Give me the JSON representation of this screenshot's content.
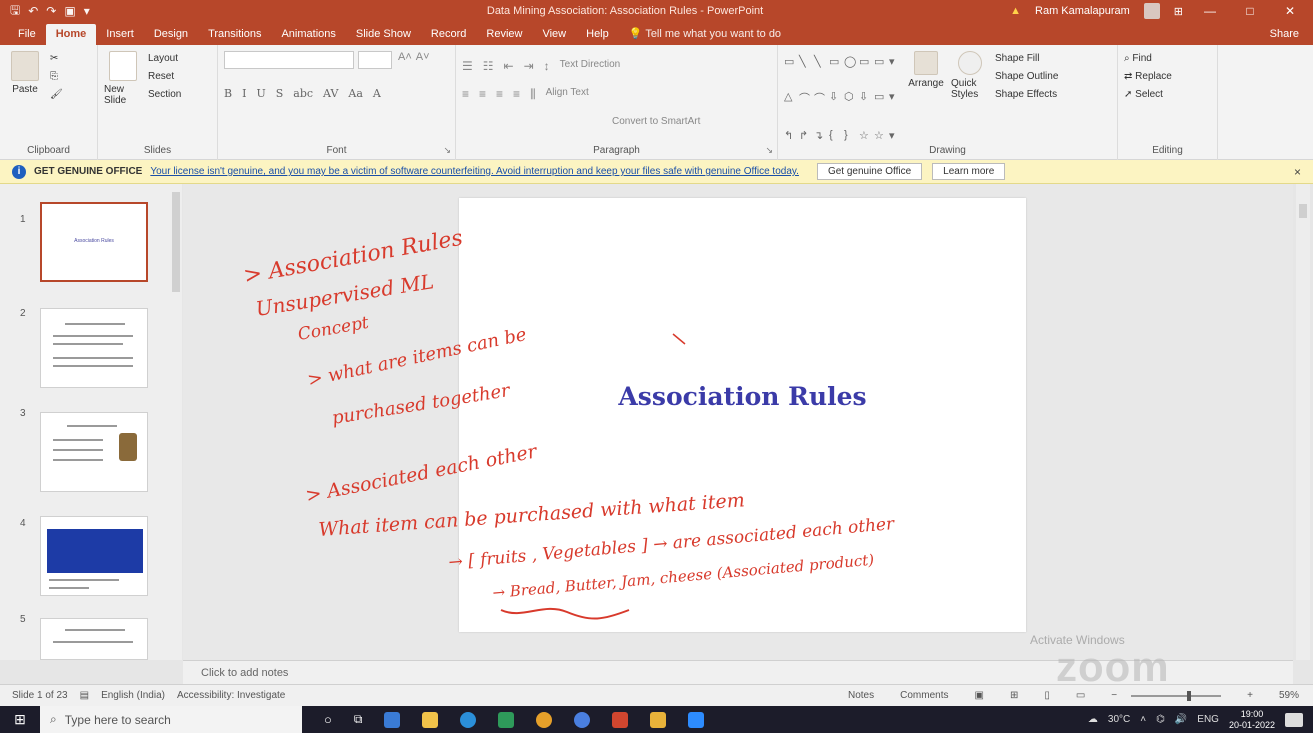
{
  "window": {
    "title": "Data Mining Association: Association Rules - PowerPoint",
    "warning_label": "Ram Kamalapuram",
    "controls": [
      "—",
      "□",
      "✕"
    ]
  },
  "tabs": [
    "File",
    "Home",
    "Insert",
    "Design",
    "Transitions",
    "Animations",
    "Slide Show",
    "Record",
    "Review",
    "View",
    "Help"
  ],
  "active_tab": "Home",
  "tell_me": "Tell me what you want to do",
  "share": "Share",
  "ribbon": {
    "clipboard": {
      "paste": "Paste",
      "label": "Clipboard"
    },
    "slides": {
      "new_slide": "New Slide",
      "layout": "Layout",
      "reset": "Reset",
      "section": "Section",
      "label": "Slides"
    },
    "font": {
      "label": "Font",
      "buttons": [
        "B",
        "I",
        "U",
        "S",
        "abc",
        "AV",
        "Aa",
        "A"
      ]
    },
    "paragraph": {
      "label": "Paragraph",
      "text_direction": "Text Direction",
      "align_text": "Align Text",
      "smartart": "Convert to SmartArt"
    },
    "drawing": {
      "arrange": "Arrange",
      "quick_styles": "Quick Styles",
      "shape_fill": "Shape Fill",
      "shape_outline": "Shape Outline",
      "shape_effects": "Shape Effects",
      "label": "Drawing"
    },
    "editing": {
      "find": "Find",
      "replace": "Replace",
      "select": "Select",
      "label": "Editing"
    }
  },
  "message_bar": {
    "heading": "GET GENUINE OFFICE",
    "body": "Your license isn't genuine, and you may be a victim of software counterfeiting. Avoid interruption and keep your files safe with genuine Office today.",
    "primary_button": "Get genuine Office",
    "secondary_button": "Learn more",
    "close": "×"
  },
  "thumbnails": [
    {
      "num": "1",
      "title": "Association Rules"
    },
    {
      "num": "2"
    },
    {
      "num": "3"
    },
    {
      "num": "4"
    },
    {
      "num": "5"
    }
  ],
  "slide": {
    "title": "Association Rules"
  },
  "ink_notes": [
    "> Association Rules",
    "Unsupervised ML",
    "Concept",
    "> what are items can be",
    "purchased together",
    "> Associated each other",
    "What item can be purchased with what item",
    "→ [ fruits , Vegetables ] → are associated each other",
    "→ Bread, Butter, Jam, cheese (Associated product)"
  ],
  "notes_placeholder": "Click to add notes",
  "watermark": {
    "activate": "Activate Windows",
    "brand": "zoom"
  },
  "status": {
    "slide_of": "Slide 1 of 23",
    "language": "English (India)",
    "accessibility": "Accessibility: Investigate",
    "notes": "Notes",
    "comments": "Comments",
    "zoom": "59%"
  },
  "taskbar": {
    "search_placeholder": "Type here to search",
    "weather": "30°C",
    "language": "ENG",
    "time": "19:00",
    "date": "20-01-2022"
  },
  "colors": {
    "accent": "#b7472a",
    "ink": "#d83a2c",
    "slide_title": "#3b3ba8"
  }
}
